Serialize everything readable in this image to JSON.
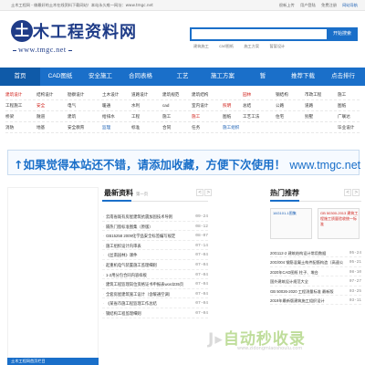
{
  "topbar": {
    "notice": "土木工程网 - 做最好的土木在线资料下载网站！本站永久唯一网址：www.tmgc.net",
    "links": [
      "很新上传",
      "",
      "用户登陆",
      "免费注册",
      "网站导航"
    ],
    "favorite": "网站导航"
  },
  "header": {
    "logo_mark": "土",
    "logo_text": "木工程资料网",
    "logo_url": "www.tmgc.net",
    "search_placeholder": "",
    "search_button": "开始搜索",
    "hot_words": [
      "建筑施工",
      "cad图纸",
      "施工方案",
      "暂暂设计"
    ]
  },
  "nav": {
    "items": [
      "首页",
      "CAD图纸",
      "安全施工",
      "合同表格",
      "工艺",
      "施工方案",
      "暂",
      "推荐下载",
      "点击排行"
    ]
  },
  "categories": [
    [
      "建筑设计",
      "结构设计",
      "勘察设计",
      "土木设计",
      "道路设计",
      "建筑规范",
      "建筑结构",
      "园林",
      "",
      "钢结构",
      "市政工程",
      "施工"
    ],
    [
      "工程施工",
      "安全",
      "电气",
      "暖通",
      "水利",
      "cad",
      "室内设计",
      "照明",
      "总结",
      "公路",
      "道路",
      "图纸"
    ],
    [
      "桥梁",
      "隧道",
      "建筑",
      "给排水",
      "工程",
      "施工",
      "施工",
      "图纸",
      "工艺工法",
      "住宅",
      "别墅",
      "广联达"
    ],
    [
      "消防",
      "地基",
      "安全教育",
      "监理",
      "标准",
      "合同",
      "任务",
      "施工组织",
      "",
      "",
      "",
      "",
      "毕业设计"
    ]
  ],
  "banner": {
    "text": "↑如果觉得本站还不错，请添加收藏，方便下次使用！",
    "url": "www.tmgc.net"
  },
  "latest": {
    "title": "最新资料",
    "subtitle": "第一页",
    "items": [
      {
        "title": "云南省既有房屋建筑抗震加固技术导则",
        "date": "09-24"
      },
      {
        "title": "隔热门窗标准图集（原版）",
        "date": "08-12"
      },
      {
        "title": "GB15258 2009化学品安全标签编写规定",
        "date": "08-07"
      },
      {
        "title": "施工组织设计内审表",
        "date": "07-14"
      },
      {
        "title": "《丝南园林》课件",
        "date": "07-04"
      },
      {
        "title": "起重机电气装置施工监理细则",
        "date": "07-04"
      },
      {
        "title": "1-2用分包合同内容样板",
        "date": "07-04"
      },
      {
        "title": "建筑工程监理岗位资格证书申报表word235页",
        "date": "07-04"
      },
      {
        "title": "全套房屋建筑施工设计（含暖通空调）",
        "date": "07-04"
      },
      {
        "title": "《某省市施工程监理工作总结",
        "date": "07-04"
      },
      {
        "title": "钢结构工程监理细则",
        "date": "07-04"
      }
    ]
  },
  "hot": {
    "title": "热门推荐",
    "thumbs": [
      "16G101-1图集",
      "GB 50300-2013 建筑工程施工质量验收统一标准"
    ],
    "items": [
      {
        "title": "16G101-1图集",
        "date": "08-19"
      },
      {
        "title": "GB 50300-2013 建筑工程施工质量验收",
        "date": "08-06"
      },
      {
        "title": "20G112-2 建筑结构设计常用数据",
        "date": "05-24"
      },
      {
        "title": "20G/004 钢筋混凝土构件配筋构造（高速公",
        "date": "05-21"
      },
      {
        "title": "2020年CAD图纸 柱子、墩台",
        "date": "08-10"
      },
      {
        "title": "国外建筑设计规范大全",
        "date": "07-27"
      },
      {
        "title": "GB 50026-2020 工程测量标准 最新版",
        "date": "03-25"
      },
      {
        "title": "2019年最新版建筑施工组织设计",
        "date": "03-11"
      }
    ]
  },
  "left_bottom": "土木工程网首页栏目",
  "watermark": {
    "logo": "自动秒收录",
    "sub": "www.zidongmiaoshoulu.com"
  }
}
